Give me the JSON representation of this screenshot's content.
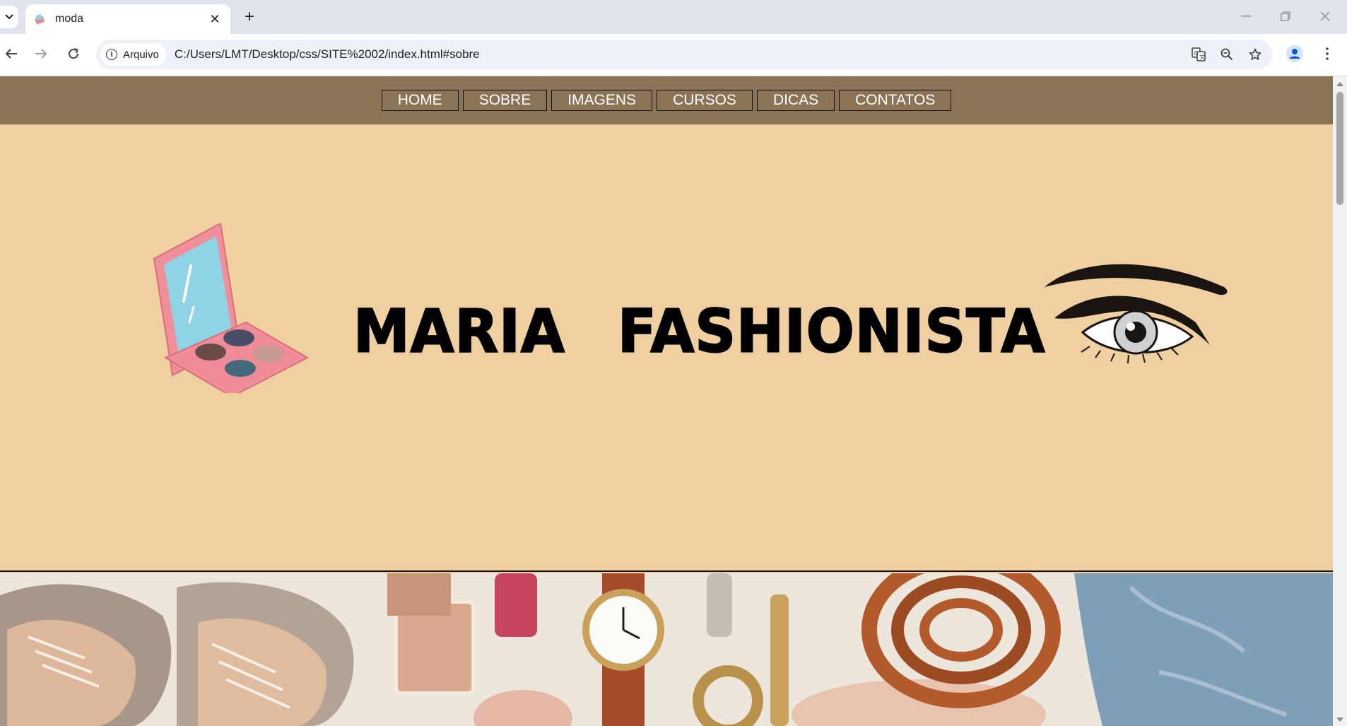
{
  "browser": {
    "tab_title": "moda",
    "new_tab_symbol": "+",
    "close_tab_symbol": "✕",
    "security_chip": "Arquivo",
    "url": "C:/Users/LMT/Desktop/css/SITE%2002/index.html#sobre",
    "icons": [
      "tab-search-icon",
      "favicon-icon",
      "close-icon",
      "new-tab-icon",
      "minimize-icon",
      "restore-icon",
      "window-close-icon",
      "back-icon",
      "forward-icon",
      "reload-icon",
      "info-icon",
      "translate-icon",
      "zoom-icon",
      "bookmark-star-icon",
      "profile-icon",
      "menu-icon"
    ]
  },
  "site": {
    "nav": [
      {
        "label": "HOME"
      },
      {
        "label": "SOBRE"
      },
      {
        "label": "IMAGENS"
      },
      {
        "label": "CURSOS"
      },
      {
        "label": "DICAS"
      },
      {
        "label": "CONTATOS"
      }
    ],
    "brand": {
      "word1": "MARIA",
      "word2": "FASHIONISTA"
    },
    "colors": {
      "navbar": "#8b7356",
      "hero_bg": "#f0cfa1",
      "nav_text": "#ffffff"
    }
  }
}
